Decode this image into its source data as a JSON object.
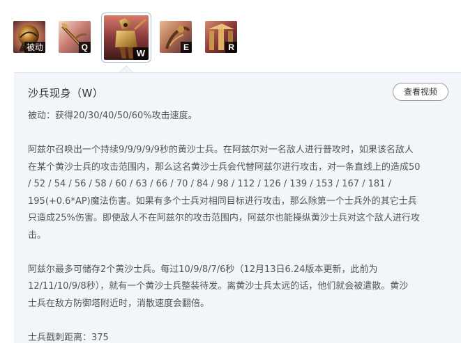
{
  "abilities": [
    {
      "key": "被动",
      "icon": "passive-orb-icon"
    },
    {
      "key": "Q",
      "icon": "q-staff-icon"
    },
    {
      "key": "W",
      "icon": "w-sand-soldier-icon",
      "selected": true
    },
    {
      "key": "E",
      "icon": "e-shifting-sands-icon"
    },
    {
      "key": "R",
      "icon": "r-emperors-divide-icon"
    }
  ],
  "panel": {
    "title": "沙兵现身（W）",
    "video_button": "查看视频",
    "passive_line": "被动：获得20/30/40/50/60%攻击速度。",
    "paragraph1": [
      "阿兹尔召唤出一个持续9/9/9/9/9秒的黄沙士兵。在阿兹尔对一名敌人进行普攻时，如果该名敌人",
      "在某个黄沙士兵的攻击范围内，那么这名黄沙士兵会代替阿兹尔进行攻击，对一条直线上的造成50",
      "/ 52 / 54 / 56 / 58 / 60 / 63 / 66 / 70 / 84 / 98 / 112 / 126 / 139 / 153 / 167 / 181 /",
      "195(+0.6*AP)魔法伤害。如果有多个士兵对相同目标进行攻击，那么除第一个士兵外的其它士兵",
      "只造成25%伤害。即使敌人不在阿兹尔的攻击范围内，阿兹尔也能操纵黄沙士兵对这个敌人进行攻",
      "击。"
    ],
    "paragraph2": [
      "阿兹尔最多可储存2个黄沙士兵。每过10/9/8/7/6秒（12月13日6.24版本更新，此前为",
      "12/11/10/9/8秒），就有一个黄沙士兵整装待发。离黄沙士兵太远的话，他们就会被遣散。黄沙",
      "士兵在敌方防御塔附近时，消散速度会翻倍。"
    ],
    "range_line": "士兵戳刺距离：375"
  }
}
